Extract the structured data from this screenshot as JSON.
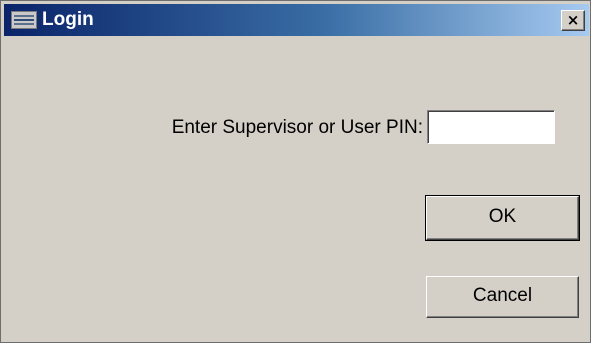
{
  "window": {
    "title": "Login",
    "close_glyph": "×",
    "icon": "app-icon",
    "close_icon": "close-icon"
  },
  "form": {
    "pin_label": "Enter Supervisor or User PIN:",
    "pin_value": ""
  },
  "buttons": {
    "ok_label": "OK",
    "cancel_label": "Cancel"
  },
  "colors": {
    "titlebar_start": "#0a246a",
    "titlebar_end": "#a6caf0",
    "face": "#d4d0c8"
  }
}
